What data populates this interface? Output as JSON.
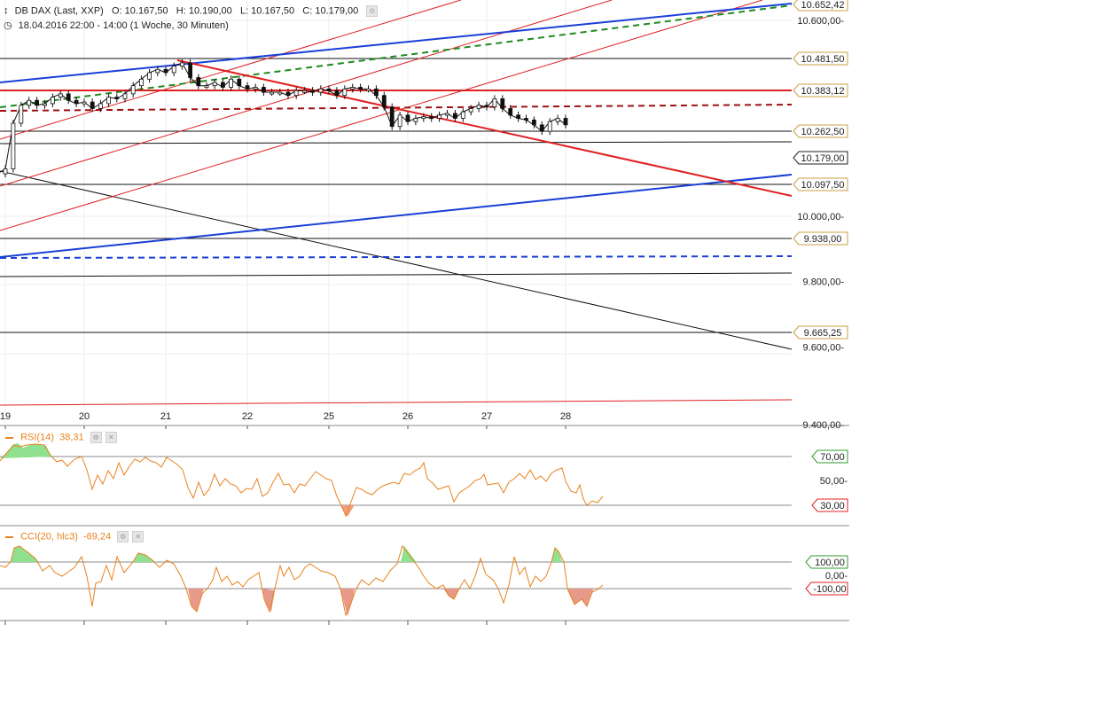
{
  "header": {
    "title": "DB DAX (Last, XXP)",
    "open": "O: 10.167,50",
    "high": "H: 10.190,00",
    "low": "L: 10.167,50",
    "close": "C: 10.179,00",
    "period": "18.04.2016 22:00 - 14:00 (1 Woche, 30 Minuten)"
  },
  "indicators": {
    "rsi": {
      "label": "RSI(14)",
      "value": "38,31",
      "levels": [
        "70,00",
        "50,00",
        "30,00"
      ]
    },
    "cci": {
      "label": "CCI(20, hlc3)",
      "value": "-69,24",
      "levels": [
        "100,00",
        "0,00",
        "-100,00"
      ]
    }
  },
  "colors": {
    "up": "#2e9b2e",
    "red": "#e02020",
    "blue": "#1a3fd6",
    "green": "#1e8a1e",
    "darkred": "#a01010",
    "orange": "#e8821e"
  },
  "chart_data": {
    "type": "line",
    "title": "DB DAX (Last, XXP)",
    "xlabel": "",
    "ylabel": "",
    "x_ticks": [
      "19",
      "20",
      "21",
      "22",
      "25",
      "26",
      "27",
      "28"
    ],
    "ylim": [
      9400,
      10670
    ],
    "y_tick_labels": [
      "10.600,00",
      "10.000,00",
      "9.800,00",
      "9.600,00",
      "9.400,00"
    ],
    "price_tags": [
      "10.652,42",
      "10.481,50",
      "10.383,12",
      "10.262,50",
      "10.179,00",
      "10.097,50",
      "9.938,00",
      "9.665,25"
    ],
    "horizontal_lines": [
      10481.5,
      10262.5,
      10218,
      10097.5,
      9938,
      9847,
      9665.25
    ],
    "series": [
      {
        "x": [
          18.9,
          19.0,
          19.1,
          19.2,
          19.3,
          19.4,
          19.5,
          19.6,
          19.7,
          19.8,
          19.9,
          20.0,
          20.1,
          20.2,
          20.3,
          20.4,
          20.5,
          20.6,
          20.7,
          20.8,
          20.9,
          21.0,
          21.1,
          21.2,
          21.3,
          21.4,
          21.5,
          21.6,
          21.7,
          21.8,
          21.9,
          22.0,
          22.1,
          22.2,
          22.3,
          22.4,
          22.5,
          22.6,
          22.7,
          22.8,
          22.9,
          23.0,
          23.1,
          23.2,
          23.3,
          23.4,
          23.5,
          23.6,
          23.7,
          23.8,
          23.9,
          24.0,
          24.1,
          24.2,
          24.3,
          24.4,
          24.5,
          24.6,
          24.7,
          24.8,
          24.9,
          25.0,
          25.1,
          25.2,
          25.3,
          25.4,
          25.5,
          25.6,
          25.7,
          25.8,
          25.9,
          26.0
        ],
        "values": [
          10130,
          10145,
          10285,
          10340,
          10355,
          10340,
          10345,
          10365,
          10375,
          10355,
          10345,
          10350,
          10330,
          10345,
          10365,
          10360,
          10375,
          10400,
          10420,
          10440,
          10450,
          10440,
          10460,
          10470,
          10425,
          10400,
          10400,
          10410,
          10395,
          10420,
          10400,
          10390,
          10395,
          10380,
          10380,
          10380,
          10370,
          10385,
          10385,
          10380,
          10390,
          10385,
          10370,
          10390,
          10395,
          10390,
          10390,
          10370,
          10335,
          10275,
          10310,
          10290,
          10300,
          10305,
          10300,
          10310,
          10315,
          10300,
          10320,
          10330,
          10340,
          10335,
          10360,
          10330,
          10310,
          10300,
          10295,
          10280,
          10260,
          10290,
          10300,
          10280
        ]
      }
    ]
  }
}
